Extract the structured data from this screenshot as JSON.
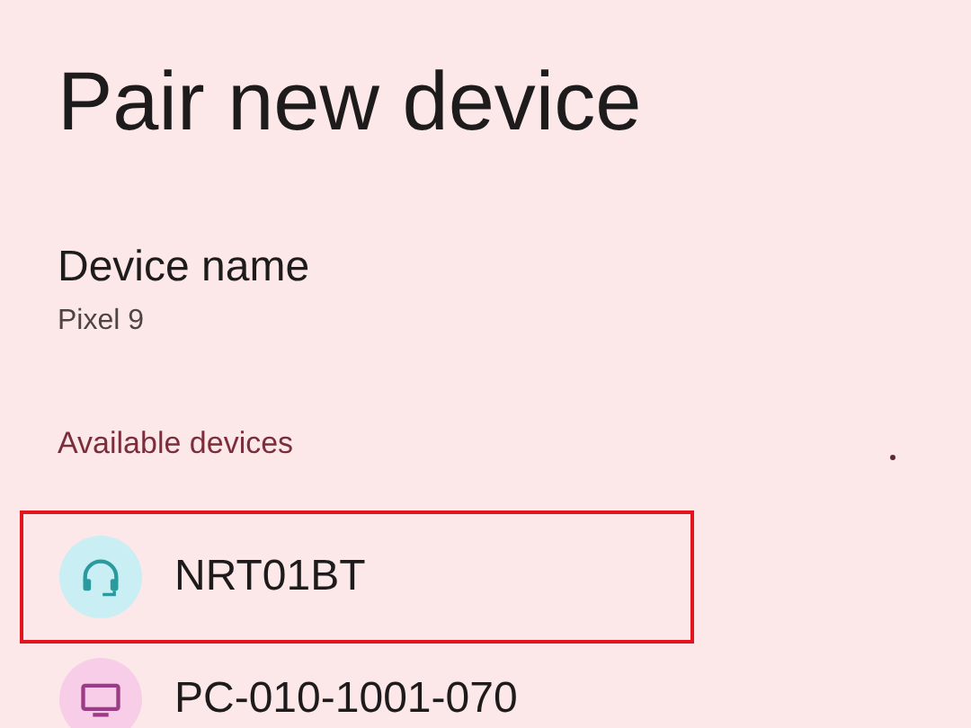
{
  "title": "Pair new device",
  "device_name": {
    "label": "Device name",
    "value": "Pixel 9"
  },
  "available": {
    "heading": "Available devices",
    "scanning": true
  },
  "devices": [
    {
      "name": "NRT01BT",
      "kind": "headset",
      "highlighted": true
    },
    {
      "name": "PC-010-1001-070",
      "kind": "computer",
      "highlighted": false
    }
  ]
}
